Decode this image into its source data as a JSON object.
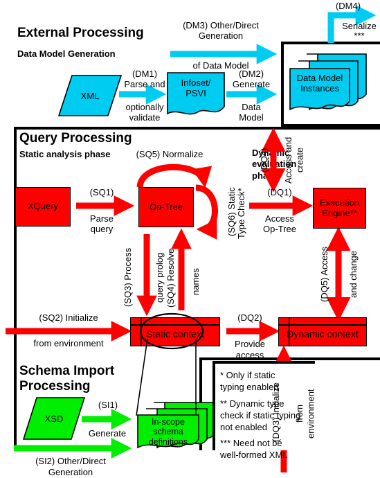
{
  "colors": {
    "red": "#FF0000",
    "cyan": "#00CCF2",
    "green": "#00EE00",
    "black": "#000000",
    "white": "#FFFFFF"
  },
  "sections": {
    "external": {
      "title": "External Processing",
      "subtitle": "Data Model Generation"
    },
    "query": {
      "title": "Query Processing",
      "subtitle_static": "Static analysis phase",
      "subtitle_dynamic": "Dynamic\nevaluation\nphase"
    },
    "schema": {
      "title": "Schema Import\nProcessing"
    }
  },
  "nodes": {
    "xml": "XML",
    "infoset": "Infoset/\nPSVI",
    "data_model_instances": "Data Model\nInstances",
    "xquery": "XQuery",
    "op_tree": "Op-Tree",
    "execution_engine": "Execution\nEngine**",
    "static_context": "Static context",
    "dynamic_context": "Dynamic context",
    "xsd": "XSD",
    "in_scope_schema": "In-scope\nschema\ndefinitions"
  },
  "edges": {
    "dm1": "(DM1)\nParse and",
    "dm1b": "optionally\nvalidate",
    "dm2": "(DM2)\nGenerate",
    "dm2b": "Data\nModel",
    "dm3": "(DM3) Other/Direct\nGeneration",
    "dm3b": "of Data Model",
    "dm4": "(DM4)",
    "dm4b": "Serialize\n***",
    "sq1": "(SQ1)",
    "sq1b": "Parse\nquery",
    "sq2": "(SQ2) Initialize",
    "sq2b": "from environment",
    "sq3": "(SQ3) Process",
    "sq3b": "query prolog",
    "sq4": "(SQ4) Resolve",
    "sq4b": "names",
    "sq5": "(SQ5) Normalize",
    "sq6": "(SQ6) Static",
    "sq6b": "Type Check*",
    "dq1": "(DQ1)",
    "dq1b": "Access\nOp-Tree",
    "dq2": "(DQ2)",
    "dq2b": "Provide\naccess",
    "dq3": "(DQ3) Initialize",
    "dq3b": "from\nenvironment",
    "dq4": "(DQ4)",
    "dq4b": "Access and\ncreate",
    "dq5": "(DQ5) Access",
    "dq5b": "and change",
    "si1": "(SI1)",
    "si1b": "Generate",
    "si2": "(SI2) Other/Direct\nGeneration"
  },
  "notes": {
    "note1": "* Only if static\ntyping enabled",
    "note2": "** Dynamic type\ncheck if static typing\nnot enabled",
    "note3": "*** Need not be\nwell-formed XML"
  }
}
